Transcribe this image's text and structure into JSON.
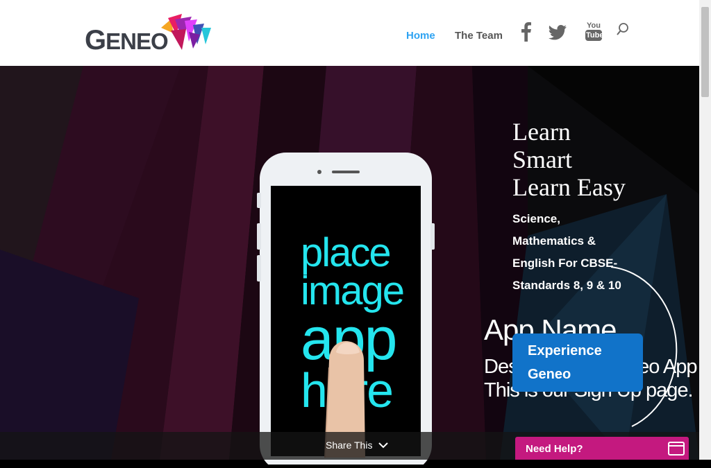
{
  "header": {
    "logo_text_first": "G",
    "logo_text_rest": "ENEO",
    "nav": [
      {
        "label": "Home",
        "active": true
      },
      {
        "label": "The Team",
        "active": false
      }
    ],
    "social_icons": [
      "facebook-icon",
      "twitter-icon",
      "youtube-icon",
      "search-icon"
    ],
    "youtube_text_top": "You",
    "youtube_text_bottom": "Tube",
    "accent_color": "#2ea3f2"
  },
  "hero": {
    "title_lines": [
      "Learn",
      "Smart",
      "Learn Easy"
    ],
    "subtitle": "Science, Mathematics & English For CBSE-Standards 8, 9 & 10",
    "phone_screen_lines": [
      "place",
      "image",
      "app",
      "here"
    ],
    "app_name": "App Name",
    "description_line1": "Description of Geneo App",
    "description_line2": "This is our Sign Up page.",
    "cta_label": "Experience Geneo",
    "cta_color": "#1173c9"
  },
  "footer": {
    "share_label": "Share This",
    "help_label": "Need Help?",
    "help_color": "#c4197f"
  }
}
